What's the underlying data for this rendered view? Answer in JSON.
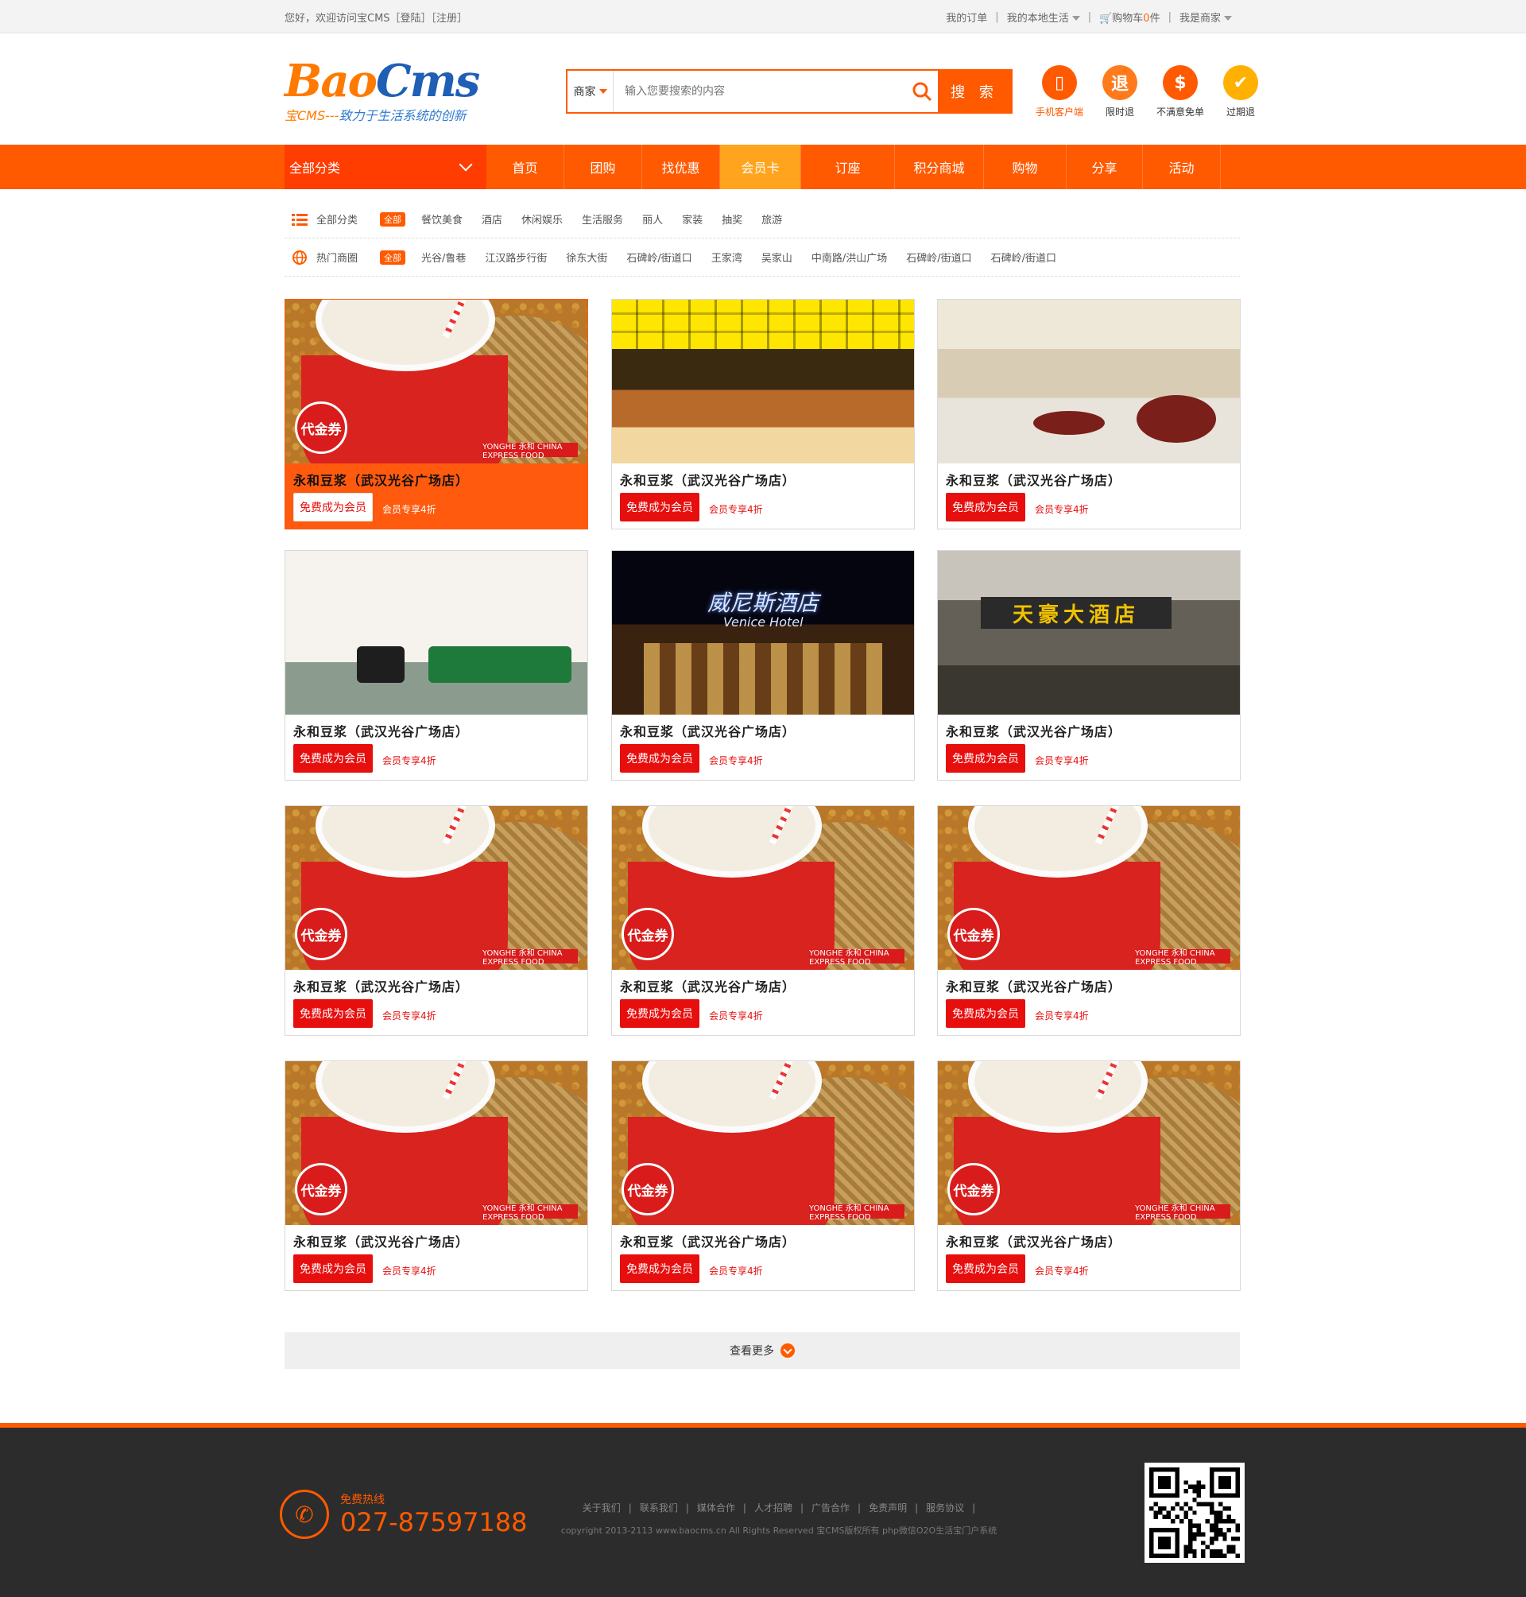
{
  "topbar": {
    "welcome": "您好，欢迎访问宝CMS［登陆］［注册］",
    "my_orders": "我的订单",
    "local_life": "我的本地生活",
    "cart_label": "购物车",
    "cart_count": "0",
    "cart_unit": "件",
    "merchant": "我是商家",
    "separator": "|"
  },
  "header": {
    "logo_bao": "Bao",
    "logo_cms": "Cms",
    "slogan_prefix": "宝CMS---",
    "slogan_rest": "致力于生活系统的创新",
    "search_scope": "商家",
    "search_placeholder": "输入您要搜索的内容",
    "search_button": "搜 索",
    "features": [
      {
        "label": "手机客户端",
        "icon": "mobile-icon",
        "glyph": "▯",
        "color": "#ff5a00"
      },
      {
        "label": "限时退",
        "icon": "refund-icon",
        "glyph": "退",
        "color": "#ff7a1a"
      },
      {
        "label": "不满意免单",
        "icon": "dollar-icon",
        "glyph": "$",
        "color": "#ff5a00"
      },
      {
        "label": "过期退",
        "icon": "check-icon",
        "glyph": "✔",
        "color": "#ffb000"
      }
    ]
  },
  "nav": {
    "all_categories": "全部分类",
    "items": [
      "首页",
      "团购",
      "找优惠",
      "会员卡",
      "订座",
      "积分商城",
      "购物",
      "分享",
      "活动"
    ],
    "active_index": 3
  },
  "filters": {
    "category": {
      "label": "全部分类",
      "all": "全部",
      "options": [
        "餐饮美食",
        "酒店",
        "休闲娱乐",
        "生活服务",
        "丽人",
        "家装",
        "抽奖",
        "旅游"
      ]
    },
    "area": {
      "label": "热门商圈",
      "all": "全部",
      "options": [
        "光谷/鲁巷",
        "江汉路步行街",
        "徐东大街",
        "石碑岭/街道口",
        "王家湾",
        "吴家山",
        "中南路/洪山广场",
        "石碑岭/街道口",
        "石碑岭/街道口"
      ]
    }
  },
  "cards": [
    {
      "title": "永和豆浆（武汉光谷广场店）",
      "cta": "免费成为会员",
      "discount": "会员专享4折",
      "image": "soy",
      "highlight": true
    },
    {
      "title": "永和豆浆（武汉光谷广场店）",
      "cta": "免费成为会员",
      "discount": "会员专享4折",
      "image": "scene1",
      "highlight": false
    },
    {
      "title": "永和豆浆（武汉光谷广场店）",
      "cta": "免费成为会员",
      "discount": "会员专享4折",
      "image": "scene2",
      "highlight": false
    },
    {
      "title": "永和豆浆（武汉光谷广场店）",
      "cta": "免费成为会员",
      "discount": "会员专享4折",
      "image": "scene3",
      "highlight": false
    },
    {
      "title": "永和豆浆（武汉光谷广场店）",
      "cta": "免费成为会员",
      "discount": "会员专享4折",
      "image": "scene4",
      "highlight": false
    },
    {
      "title": "永和豆浆（武汉光谷广场店）",
      "cta": "免费成为会员",
      "discount": "会员专享4折",
      "image": "scene5",
      "highlight": false
    },
    {
      "title": "永和豆浆（武汉光谷广场店）",
      "cta": "免费成为会员",
      "discount": "会员专享4折",
      "image": "soy",
      "highlight": false
    },
    {
      "title": "永和豆浆（武汉光谷广场店）",
      "cta": "免费成为会员",
      "discount": "会员专享4折",
      "image": "soy",
      "highlight": false
    },
    {
      "title": "永和豆浆（武汉光谷广场店）",
      "cta": "免费成为会员",
      "discount": "会员专享4折",
      "image": "soy",
      "highlight": false
    },
    {
      "title": "永和豆浆（武汉光谷广场店）",
      "cta": "免费成为会员",
      "discount": "会员专享4折",
      "image": "soy",
      "highlight": false
    },
    {
      "title": "永和豆浆（武汉光谷广场店）",
      "cta": "免费成为会员",
      "discount": "会员专享4折",
      "image": "soy",
      "highlight": false
    },
    {
      "title": "永和豆浆（武汉光谷广场店）",
      "cta": "免费成为会员",
      "discount": "会员专享4折",
      "image": "soy",
      "highlight": false
    }
  ],
  "image_text": {
    "voucher_badge": "代金券",
    "brand_strip": "YONGHE 永和 CHINA EXPRESS FOOD",
    "venice_cn": "威尼斯酒店",
    "venice_en": "Venice Hotel",
    "tianhao": "天豪大酒店"
  },
  "more": {
    "label": "查看更多"
  },
  "footer": {
    "hotline_label": "免费热线",
    "hotline_number": "027-87597188",
    "links": [
      "关于我们",
      "联系我们",
      "媒体合作",
      "人才招聘",
      "广告合作",
      "免责声明",
      "服务协议"
    ],
    "copyright": "copyright 2013-2113 www.baocms.cn All Rights Reserved 宝CMS版权所有 php微信O2O生活宝门户系统"
  },
  "colors": {
    "accent": "#ff5a00",
    "nav_active": "#ffa41c",
    "cta_red": "#e70e0e"
  }
}
